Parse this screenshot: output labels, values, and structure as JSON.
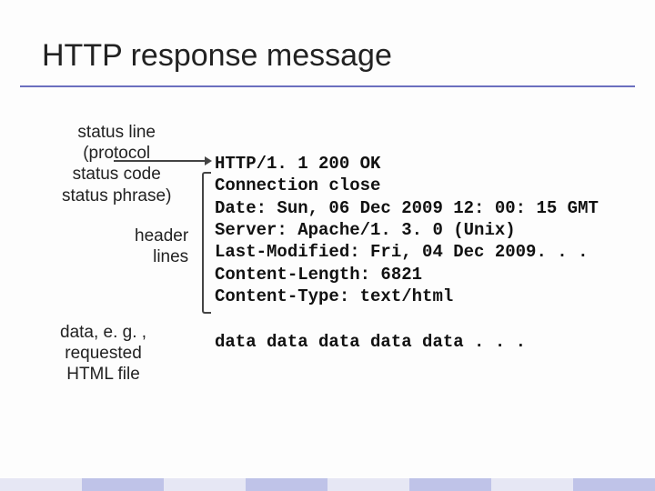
{
  "title": "HTTP response message",
  "labels": {
    "status": "status line\n(protocol\nstatus code\nstatus phrase)",
    "header": "header\nlines",
    "data": "data, e. g. ,\nrequested\nHTML file"
  },
  "response": {
    "status_line": "HTTP/1. 1 200 OK",
    "headers": [
      "Connection close",
      "Date: Sun, 06 Dec 2009 12: 00: 15 GMT",
      "Server: Apache/1. 3. 0 (Unix)",
      "Last-Modified: Fri, 04 Dec 2009. . .",
      "Content-Length: 6821",
      "Content-Type: text/html"
    ],
    "body": "data data data data data . . ."
  },
  "colors": {
    "rule": "#6b6fbf"
  }
}
